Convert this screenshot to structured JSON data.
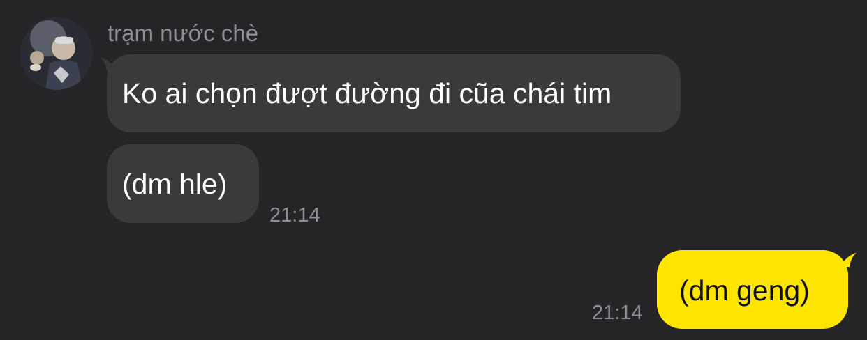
{
  "conversation": {
    "incoming": {
      "sender_name": "trạm nước chè",
      "avatar_icon": "user-avatar-photo",
      "messages": [
        "Ko ai chọn đượt đường đi cũa chái tim",
        "(dm hle)"
      ],
      "time": "21:14"
    },
    "outgoing": {
      "messages": [
        "(dm geng)"
      ],
      "time": "21:14"
    }
  },
  "colors": {
    "background": "#252527",
    "incoming_bubble": "#3a3a3c",
    "outgoing_bubble": "#fee500",
    "meta_text": "#8e8e93"
  }
}
